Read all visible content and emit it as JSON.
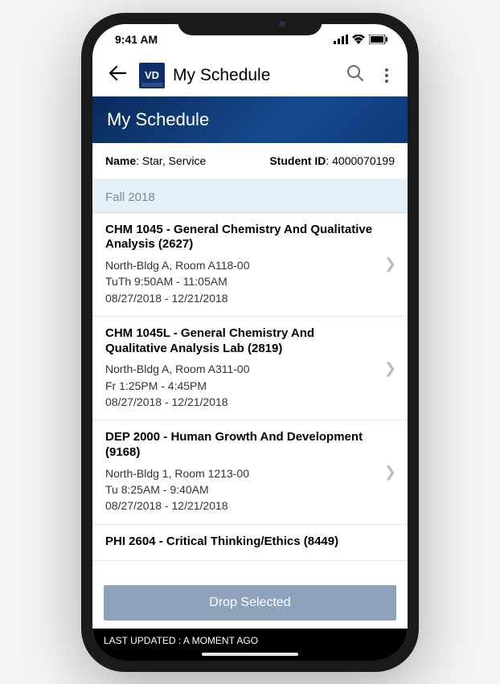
{
  "status": {
    "time": "9:41 AM"
  },
  "header": {
    "title": "My Schedule",
    "logo_text": "VD"
  },
  "banner": {
    "title": "My Schedule"
  },
  "student": {
    "name_label": "Name",
    "name_value": "Star, Service",
    "id_label": "Student ID",
    "id_value": "4000070199"
  },
  "term": {
    "label": "Fall 2018"
  },
  "courses": [
    {
      "title": "CHM 1045 - General Chemistry And Qualitative Analysis (2627)",
      "location": "North-Bldg A, Room A118-00",
      "time": "TuTh 9:50AM - 11:05AM",
      "dates": "08/27/2018 - 12/21/2018"
    },
    {
      "title": "CHM 1045L - General Chemistry And Qualitative Analysis Lab (2819)",
      "location": "North-Bldg A, Room A311-00",
      "time": "Fr 1:25PM - 4:45PM",
      "dates": "08/27/2018 - 12/21/2018"
    },
    {
      "title": "DEP 2000 - Human Growth And Development (9168)",
      "location": "North-Bldg 1, Room 1213-00",
      "time": "Tu 8:25AM - 9:40AM",
      "dates": "08/27/2018 - 12/21/2018"
    },
    {
      "title": "PHI 2604 - Critical Thinking/Ethics (8449)"
    }
  ],
  "actions": {
    "drop_label": "Drop Selected"
  },
  "footer": {
    "updated": "LAST UPDATED : A MOMENT AGO"
  }
}
